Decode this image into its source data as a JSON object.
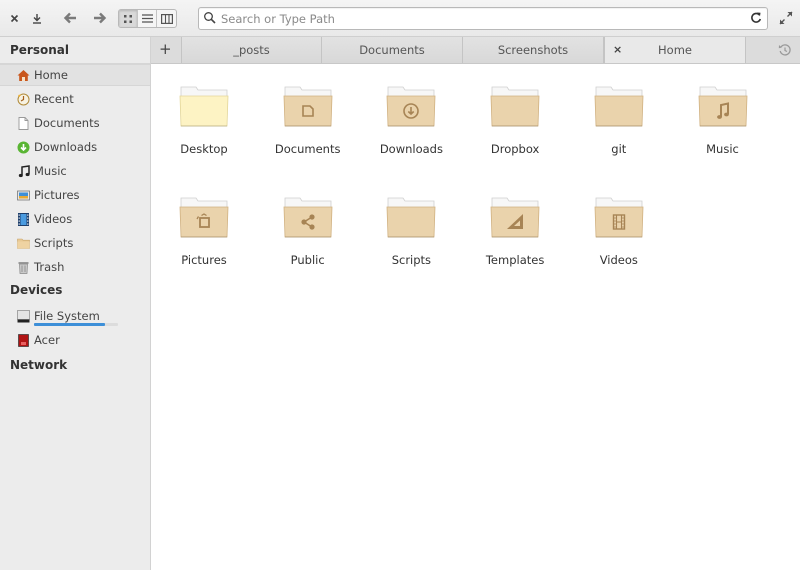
{
  "headerbar": {
    "close_icon": "close-icon",
    "download_icon": "download-icon",
    "back_icon": "arrow-left-icon",
    "forward_icon": "arrow-right-icon",
    "view_modes": [
      {
        "name": "icon-view",
        "icon": "grid-icon",
        "active": true
      },
      {
        "name": "list-view",
        "icon": "list-icon",
        "active": false
      },
      {
        "name": "column-view",
        "icon": "columns-icon",
        "active": false
      }
    ],
    "search": {
      "value": "",
      "placeholder": "Search or Type Path"
    },
    "reload_icon": "reload-icon",
    "fullscreen_icon": "fullscreen-icon"
  },
  "sidebar": {
    "sections": [
      {
        "title": "Personal"
      },
      {
        "title": "Devices"
      },
      {
        "title": "Network"
      }
    ],
    "personal": [
      {
        "label": "Home",
        "icon": "home-icon",
        "selected": true
      },
      {
        "label": "Recent",
        "icon": "recent-icon"
      },
      {
        "label": "Documents",
        "icon": "document-icon"
      },
      {
        "label": "Downloads",
        "icon": "download-icon"
      },
      {
        "label": "Music",
        "icon": "music-icon"
      },
      {
        "label": "Pictures",
        "icon": "pictures-icon"
      },
      {
        "label": "Videos",
        "icon": "videos-icon"
      },
      {
        "label": "Scripts",
        "icon": "folder-icon"
      },
      {
        "label": "Trash",
        "icon": "trash-icon"
      }
    ],
    "devices": [
      {
        "label": "File System",
        "icon": "drive-icon",
        "usage_fraction": 0.85
      },
      {
        "label": "Acer",
        "icon": "removable-drive-icon"
      }
    ]
  },
  "tabs": {
    "new_tab_label": "+",
    "items": [
      {
        "label": "_posts",
        "active": false
      },
      {
        "label": "Documents",
        "active": false
      },
      {
        "label": "Screenshots",
        "active": false
      },
      {
        "label": "Home",
        "active": true,
        "close_label": "×"
      }
    ],
    "history_icon": "history-icon"
  },
  "folders": [
    {
      "label": "Desktop",
      "emblem": "none",
      "variant": "desktop"
    },
    {
      "label": "Documents",
      "emblem": "document"
    },
    {
      "label": "Downloads",
      "emblem": "download"
    },
    {
      "label": "Dropbox",
      "emblem": "none"
    },
    {
      "label": "git",
      "emblem": "none"
    },
    {
      "label": "Music",
      "emblem": "music"
    },
    {
      "label": "Pictures",
      "emblem": "pictures"
    },
    {
      "label": "Public",
      "emblem": "share"
    },
    {
      "label": "Scripts",
      "emblem": "none"
    },
    {
      "label": "Templates",
      "emblem": "templates"
    },
    {
      "label": "Videos",
      "emblem": "video"
    }
  ],
  "colors": {
    "folder_fill": "#ead3ac",
    "folder_emblem": "#a78455",
    "accent": "#3d8fd8"
  }
}
